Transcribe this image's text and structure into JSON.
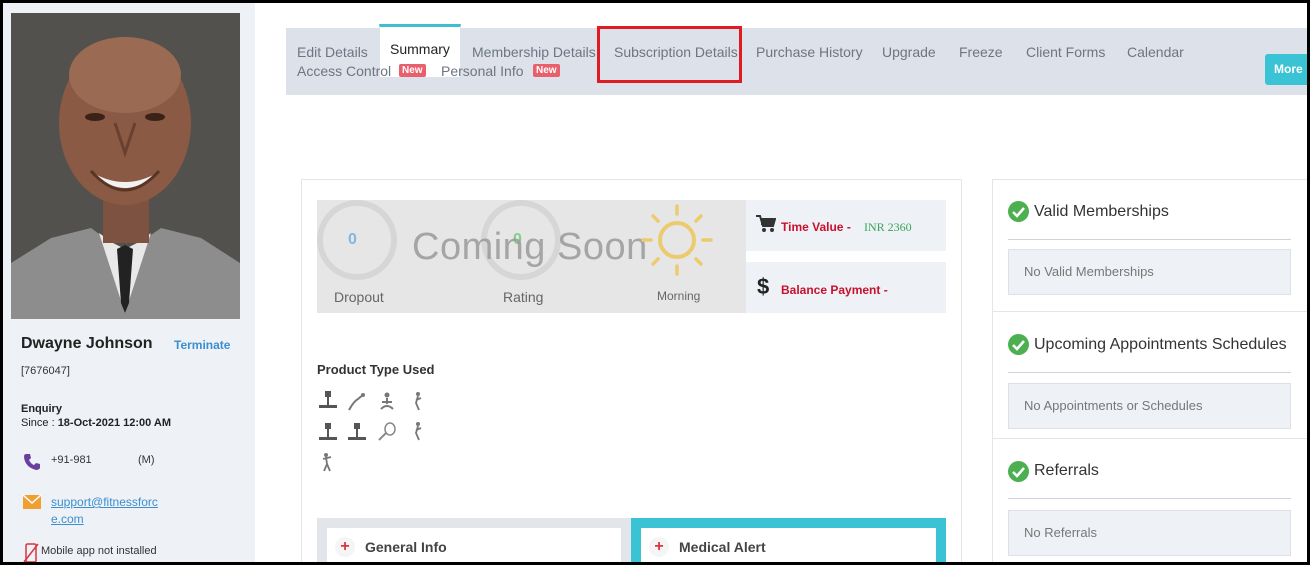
{
  "profile": {
    "name": "Dwayne Johnson",
    "terminate_label": "Terminate",
    "member_id": "[7676047]",
    "status": "Enquiry",
    "since_label": "Since : ",
    "since_value": "18-Oct-2021 12:00 AM",
    "phone": "+91-981",
    "phone_type": "(M)",
    "email": "support@fitnessforce.com",
    "mobile_note": "Mobile app not installed"
  },
  "tabs": {
    "edit_details": "Edit Details",
    "summary": "Summary",
    "membership_details": "Membership Details",
    "subscription_details": "Subscription Details",
    "purchase_history": "Purchase History",
    "upgrade": "Upgrade",
    "freeze": "Freeze",
    "client_forms": "Client Forms",
    "calendar": "Calendar",
    "access_control": "Access Control",
    "personal_info": "Personal Info",
    "new_badge": "New",
    "more": "More"
  },
  "stats": {
    "dropout_value": "0",
    "dropout_label": "Dropout",
    "rating_value": "0",
    "rating_label": "Rating",
    "coming_soon": "Coming Soon",
    "morning_label": "Morning",
    "time_value_label": "Time Value -",
    "time_value": "INR 2360",
    "balance_label": "Balance Payment -"
  },
  "product_type": {
    "title": "Product Type Used",
    "icons": [
      "gym-machine-icon",
      "stretch-icon",
      "yoga-icon",
      "dance-icon",
      "gym-machine-icon",
      "gym-machine-icon",
      "tennis-icon",
      "dance-icon",
      "fitness-person-icon"
    ]
  },
  "info_cards": {
    "general": "General Info",
    "medical": "Medical Alert"
  },
  "right": {
    "valid_title": "Valid Memberships",
    "valid_empty": "No Valid Memberships",
    "appt_title": "Upcoming Appointments Schedules",
    "appt_empty": "No Appointments or Schedules",
    "ref_title": "Referrals",
    "ref_empty": "No Referrals"
  },
  "colors": {
    "accent": "#3dbfcf",
    "alert_red": "#c8102e",
    "success_green": "#4caf50",
    "link_blue": "#3a8fd0",
    "badge_red": "#e8606b",
    "highlight_red": "#e01b24"
  }
}
